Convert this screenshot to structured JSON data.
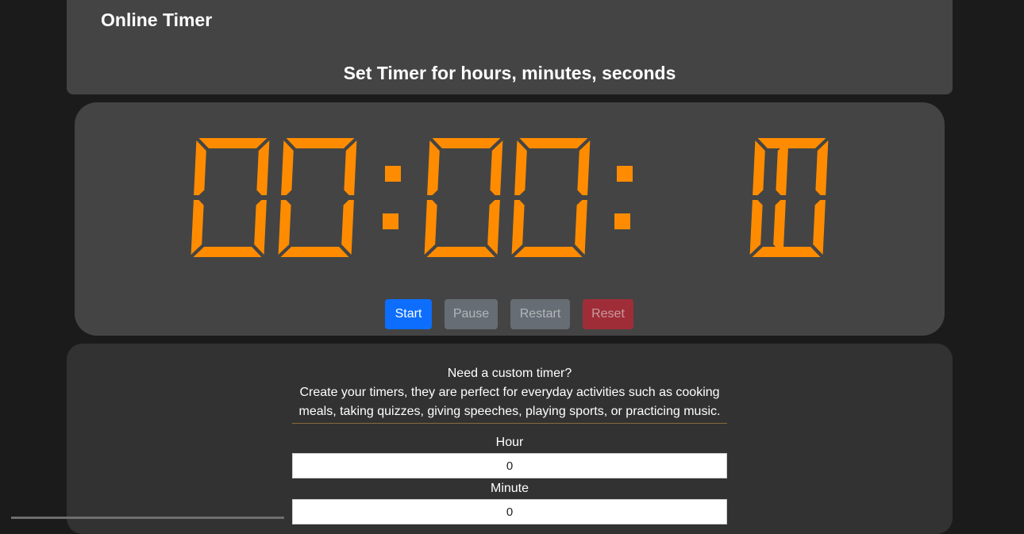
{
  "header": {
    "app_title": "Online Timer",
    "subtitle": "Set Timer for hours, minutes, seconds"
  },
  "timer": {
    "hours": "00",
    "minutes": "00",
    "seconds": " 10",
    "display_text": "00:00: 10",
    "digit_color": "#ff8c00",
    "buttons": {
      "start_label": "Start",
      "pause_label": "Pause",
      "restart_label": "Restart",
      "reset_label": "Reset"
    }
  },
  "custom": {
    "heading": "Need a custom timer?",
    "description_line1": "Create your timers, they are perfect for everyday activities such as cooking",
    "description_line2": "meals, taking quizzes, giving speeches, playing sports, or practicing music.",
    "hour_label": "Hour",
    "hour_value": "0",
    "minute_label": "Minute",
    "minute_value": "0"
  }
}
